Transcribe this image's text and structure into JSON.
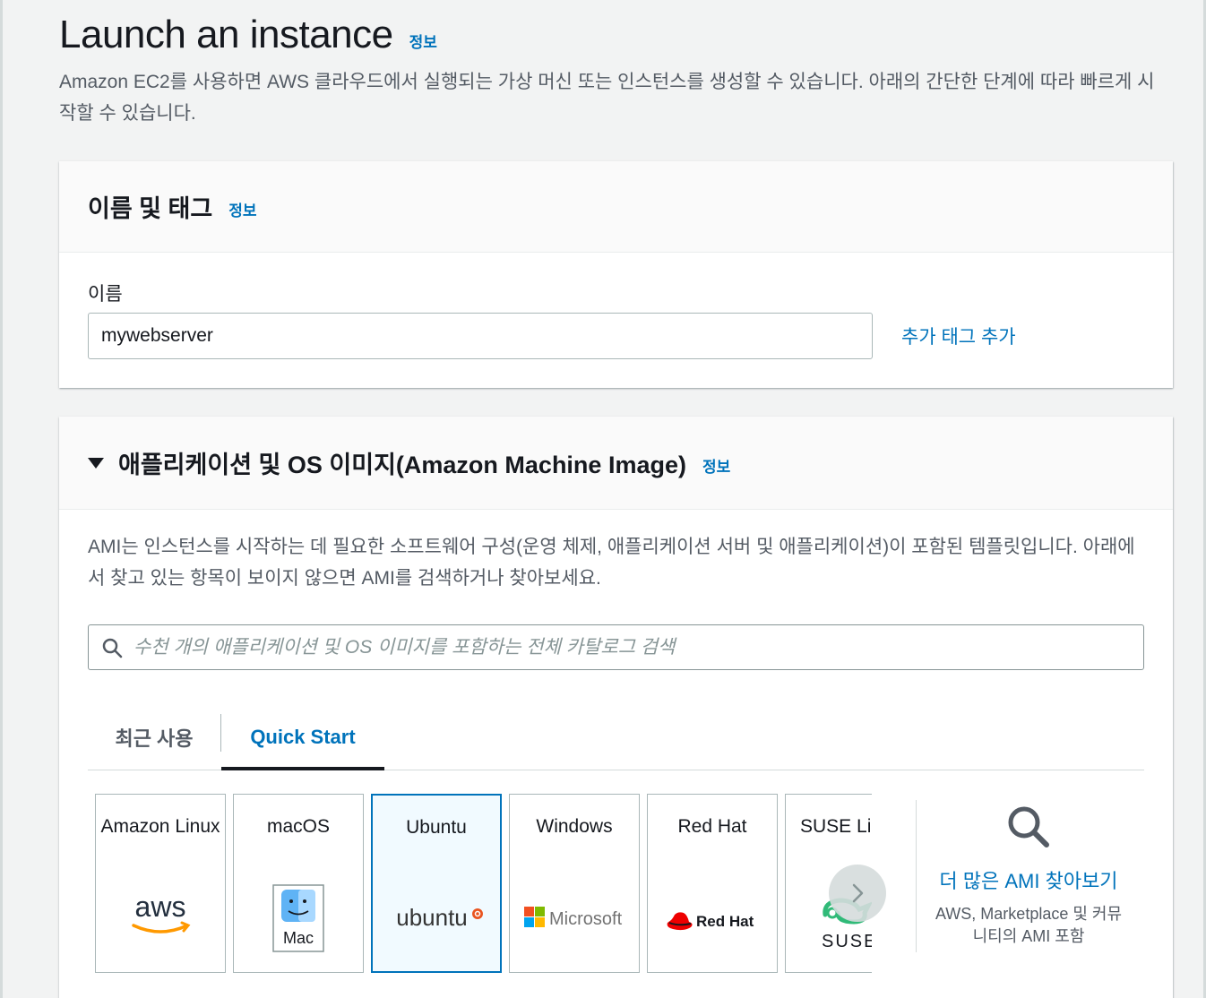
{
  "header": {
    "title": "Launch an instance",
    "info": "정보",
    "description": "Amazon EC2를 사용하면 AWS 클라우드에서 실행되는 가상 머신 또는 인스턴스를 생성할 수 있습니다. 아래의 간단한 단계에 따라 빠르게 시작할 수 있습니다."
  },
  "name_panel": {
    "title": "이름 및 태그",
    "info": "정보",
    "field_label": "이름",
    "name_value": "mywebserver",
    "add_tag_label": "추가 태그 추가"
  },
  "ami_panel": {
    "title": "애플리케이션 및 OS 이미지(Amazon Machine Image)",
    "info": "정보",
    "description": "AMI는 인스턴스를 시작하는 데 필요한 소프트웨어 구성(운영 체제, 애플리케이션 서버 및 애플리케이션)이 포함된 템플릿입니다. 아래에서 찾고 있는 항목이 보이지 않으면 AMI를 검색하거나 찾아보세요.",
    "search_placeholder": "수천 개의 애플리케이션 및 OS 이미지를 포함하는 전체 카탈로그 검색",
    "tabs": [
      {
        "label": "최근 사용",
        "active": false
      },
      {
        "label": "Quick Start",
        "active": true
      }
    ],
    "os_cards": [
      {
        "name": "Amazon Linux",
        "logo_text": "aws",
        "icon": "aws-logo-icon"
      },
      {
        "name": "macOS",
        "logo_text": "Mac",
        "icon": "finder-mac-icon"
      },
      {
        "name": "Ubuntu",
        "logo_text": "ubuntu",
        "icon": "ubuntu-logo-icon",
        "selected": true
      },
      {
        "name": "Windows",
        "logo_text": "Microsoft",
        "icon": "microsoft-logo-icon"
      },
      {
        "name": "Red Hat",
        "logo_text": "Red Hat",
        "icon": "redhat-logo-icon"
      },
      {
        "name": "SUSE Linux",
        "logo_text": "SUSE",
        "icon": "suse-logo-icon"
      }
    ],
    "browse_more": {
      "link": "더 많은 AMI 찾아보기",
      "subtext": "AWS, Marketplace 및 커뮤니티의 AMI 포함"
    }
  },
  "colors": {
    "link": "#0073bb",
    "selected_border": "#0073bb",
    "selected_bg": "#f1faff",
    "aws_orange": "#ff9900",
    "redhat_red": "#ee0000",
    "suse_green": "#30ba78",
    "ubuntu_orange": "#e95420"
  }
}
